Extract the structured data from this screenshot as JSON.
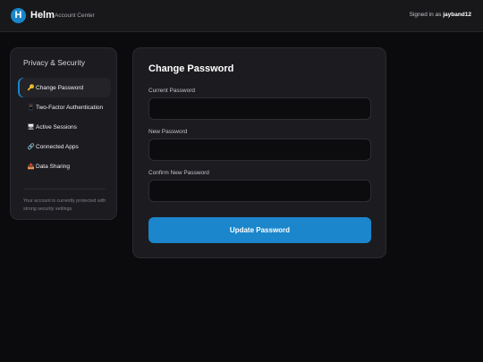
{
  "header": {
    "logo_letter": "H",
    "app_name": "Helm",
    "app_subtitle": "Account Center",
    "signed_in_prefix": "Signed in as",
    "username": "jayband12"
  },
  "sidebar": {
    "title": "Privacy & Security",
    "items": [
      {
        "icon": "key-icon",
        "glyph": "🔑",
        "label": "Change Password",
        "active": true
      },
      {
        "icon": "phone-icon",
        "glyph": "📱",
        "label": "Two-Factor Authentication",
        "active": false
      },
      {
        "icon": "monitor-icon",
        "glyph": "🖥",
        "label": "Active Sessions",
        "active": false
      },
      {
        "icon": "link-icon",
        "glyph": "🔗",
        "label": "Connected Apps",
        "active": false
      },
      {
        "icon": "outbox-icon",
        "glyph": "📤",
        "label": "Data Sharing",
        "active": false
      }
    ],
    "note": "Your account is currently protected with strong security settings."
  },
  "form": {
    "title": "Change Password",
    "current_label": "Current Password",
    "current_value": "",
    "new_label": "New Password",
    "new_value": "",
    "confirm_label": "Confirm New Password",
    "confirm_value": "",
    "submit_label": "Update Password"
  },
  "colors": {
    "accent": "#1b86cb",
    "background": "#0b0b0d",
    "panel": "#1c1c20"
  }
}
